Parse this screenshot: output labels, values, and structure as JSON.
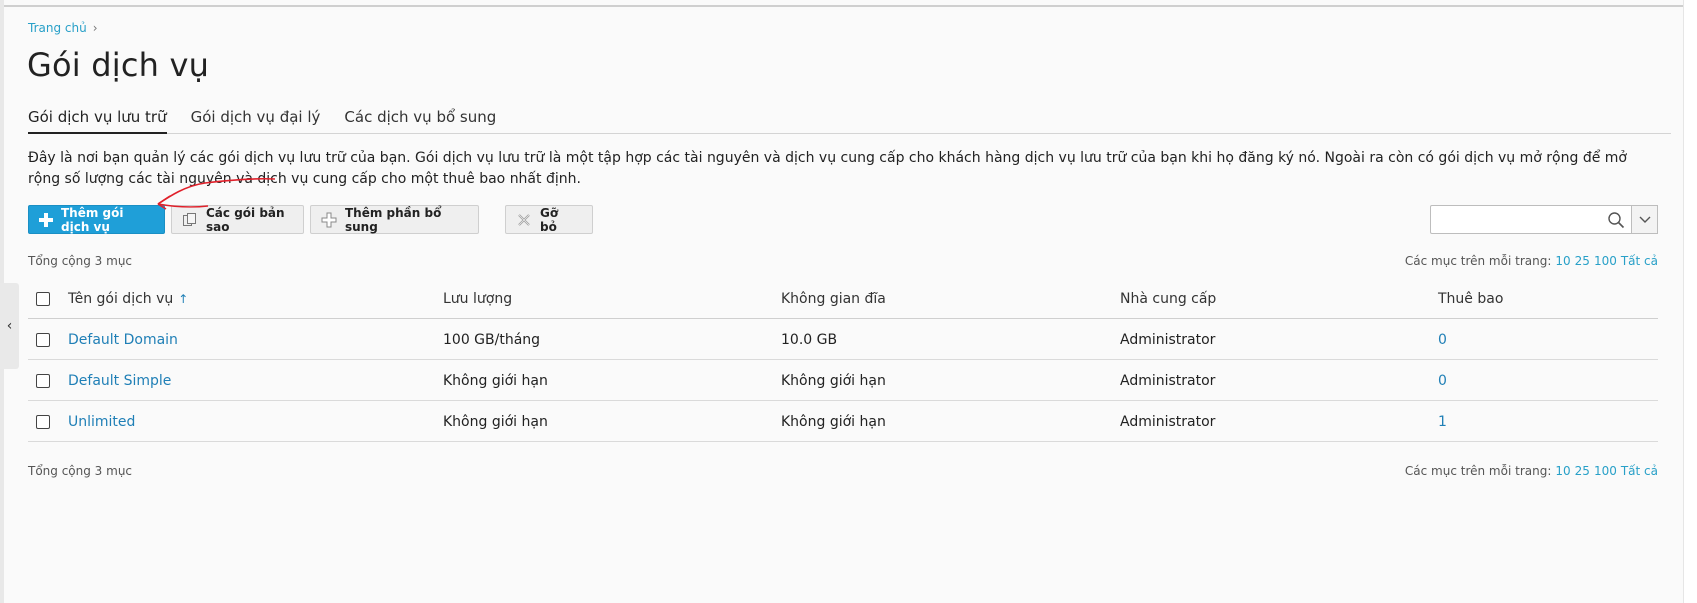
{
  "breadcrumb": {
    "home": "Trang chủ",
    "separator": "›"
  },
  "page": {
    "title": "Gói dịch vụ"
  },
  "tabs": [
    {
      "label": "Gói dịch vụ lưu trữ",
      "active": true
    },
    {
      "label": "Gói dịch vụ đại lý",
      "active": false
    },
    {
      "label": "Các dịch vụ bổ sung",
      "active": false
    }
  ],
  "description": "Đây là nơi bạn quản lý các gói dịch vụ lưu trữ của bạn. Gói dịch vụ lưu trữ là một tập hợp các tài nguyên và dịch vụ cung cấp cho khách hàng dịch vụ lưu trữ của bạn khi họ đăng ký nó. Ngoài ra còn có gói dịch vụ mở rộng để mở rộng số lượng các tài nguyên và dịch vụ cung cấp cho một thuê bao nhất định.",
  "toolbar": {
    "add_plan": "Thêm gói dịch vụ",
    "copies": "Các gói bản sao",
    "add_addon": "Thêm phần bổ sung",
    "remove": "Gỡ bỏ"
  },
  "search": {
    "placeholder": ""
  },
  "list": {
    "total_label": "Tổng cộng 3 mục",
    "per_page_label": "Các mục trên mỗi trang:",
    "per_page_options": [
      "10",
      "25",
      "100",
      "Tất cả"
    ],
    "columns": {
      "name": "Tên gói dịch vụ",
      "traffic": "Lưu lượng",
      "disk": "Không gian đĩa",
      "provider": "Nhà cung cấp",
      "subscriptions": "Thuê bao"
    },
    "sort_indicator": "↑",
    "rows": [
      {
        "name": "Default Domain",
        "traffic": "100 GB/tháng",
        "disk": "10.0 GB",
        "provider": "Administrator",
        "subscriptions": "0"
      },
      {
        "name": "Default Simple",
        "traffic": "Không giới hạn",
        "disk": "Không giới hạn",
        "provider": "Administrator",
        "subscriptions": "0"
      },
      {
        "name": "Unlimited",
        "traffic": "Không giới hạn",
        "disk": "Không giới hạn",
        "provider": "Administrator",
        "subscriptions": "1"
      }
    ]
  },
  "colors": {
    "accent": "#1f9fd8",
    "link": "#1f7fb6",
    "annotation": "#e0202a"
  },
  "icons": {
    "sidebar_toggle": "chevron-left-icon",
    "add": "plus-icon",
    "copy": "copy-icon",
    "addon": "plus-outline-icon",
    "remove": "x-icon",
    "search": "search-icon",
    "dropdown": "chevron-down-icon"
  }
}
